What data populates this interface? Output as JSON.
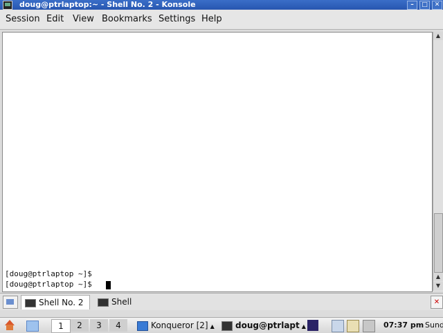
{
  "window": {
    "title": "doug@ptrlaptop:~ - Shell No. 2 - Konsole",
    "buttons": {
      "minimize": "–",
      "maximize": "□",
      "close": "✕"
    }
  },
  "menu": [
    "Session",
    "Edit",
    "View",
    "Bookmarks",
    "Settings",
    "Help"
  ],
  "terminal": {
    "lines": [
      "[doug@ptrlaptop ~]$",
      "[doug@ptrlaptop ~]$ "
    ]
  },
  "tabs": [
    {
      "label": "Shell No. 2",
      "active": true,
      "icon": "terminal-icon"
    },
    {
      "label": "Shell",
      "active": false,
      "icon": "terminal-icon"
    }
  ],
  "taskbar": {
    "desktops": [
      "1",
      "2",
      "3",
      "4"
    ],
    "tasks": [
      {
        "label": "Konqueror [2]",
        "icon": "konqueror-icon"
      },
      {
        "label": "doug@ptrlapt",
        "icon": "terminal-icon"
      }
    ],
    "clock": "07:37 pm",
    "date": "Sund"
  },
  "colors": {
    "titlebar": "#2756b0",
    "terminal_bg": "#ffffff"
  }
}
